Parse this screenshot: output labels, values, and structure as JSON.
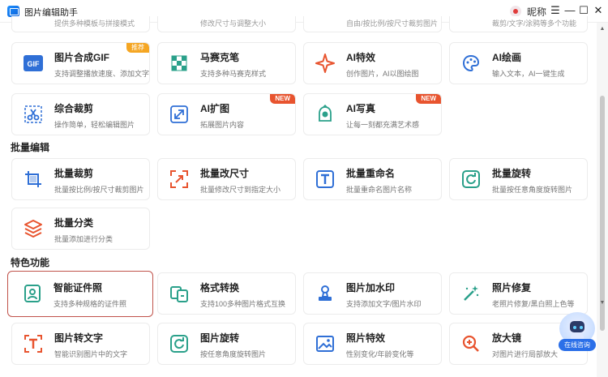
{
  "app": {
    "title": "图片编辑助手",
    "nickname": "昵称"
  },
  "window_controls": {
    "menu": "☰",
    "minimize": "—",
    "maximize": "☐",
    "close": "✕"
  },
  "top_row_partial": [
    {
      "desc": "提供多种模板与拼接模式"
    },
    {
      "desc": "修改尺寸与调整大小"
    },
    {
      "desc": "自由/按比例/按尺寸裁剪图片"
    },
    {
      "desc": "裁剪/文字/涂鸦等多个功能"
    }
  ],
  "row1": [
    {
      "title": "图片合成GIF",
      "desc": "支持调整播放速度、添加文字",
      "tag": "推荐",
      "icon": "gif-icon"
    },
    {
      "title": "马赛克笔",
      "desc": "支持多种马赛克样式",
      "icon": "mosaic-icon"
    },
    {
      "title": "AI特效",
      "desc": "创作图片，AI以图绘图",
      "icon": "sparkle-icon"
    },
    {
      "title": "AI绘画",
      "desc": "输入文本，AI一键生成",
      "icon": "palette-icon"
    }
  ],
  "row2": [
    {
      "title": "综合裁剪",
      "desc": "操作简单，轻松编辑图片",
      "icon": "scissors-icon"
    },
    {
      "title": "AI扩图",
      "desc": "拓展图片内容",
      "tag": "NEW",
      "icon": "expand-icon"
    },
    {
      "title": "AI写真",
      "desc": "让每一刻都充满艺术感",
      "tag": "NEW",
      "icon": "portrait-icon"
    }
  ],
  "sections": {
    "batch": "批量编辑",
    "special": "特色功能"
  },
  "batch": [
    {
      "title": "批量裁剪",
      "desc": "批量按比例/按尺寸裁剪图片",
      "icon": "batch-crop-icon"
    },
    {
      "title": "批量改尺寸",
      "desc": "批量修改尺寸到指定大小",
      "icon": "batch-resize-icon"
    },
    {
      "title": "批量重命名",
      "desc": "批量重命名图片名称",
      "icon": "batch-rename-icon"
    },
    {
      "title": "批量旋转",
      "desc": "批量按任意角度旋转图片",
      "icon": "batch-rotate-icon"
    },
    {
      "title": "批量分类",
      "desc": "批量添加进行分类",
      "icon": "batch-classify-icon"
    }
  ],
  "special": [
    {
      "title": "智能证件照",
      "desc": "支持多种规格的证件照",
      "icon": "id-photo-icon"
    },
    {
      "title": "格式转换",
      "desc": "支持100多种图片格式互换",
      "icon": "format-convert-icon"
    },
    {
      "title": "图片加水印",
      "desc": "支持添加文字/图片水印",
      "icon": "watermark-icon"
    },
    {
      "title": "照片修复",
      "desc": "老照片修复/黑白照上色等",
      "icon": "restore-icon"
    },
    {
      "title": "图片转文字",
      "desc": "智能识别图片中的文字",
      "icon": "ocr-icon"
    },
    {
      "title": "图片旋转",
      "desc": "按任意角度旋转图片",
      "icon": "rotate-icon"
    },
    {
      "title": "照片特效",
      "desc": "性别变化/年龄变化等",
      "icon": "photo-effect-icon"
    },
    {
      "title": "放大镜",
      "desc": "对图片进行局部放大",
      "icon": "magnifier-icon"
    }
  ],
  "chat": {
    "label": "在线咨询"
  },
  "colors": {
    "accent": "#2b6fe8",
    "selected_border": "#c0524a",
    "new_tag": "#e8542f",
    "recommend_tag": "#f5a623"
  }
}
